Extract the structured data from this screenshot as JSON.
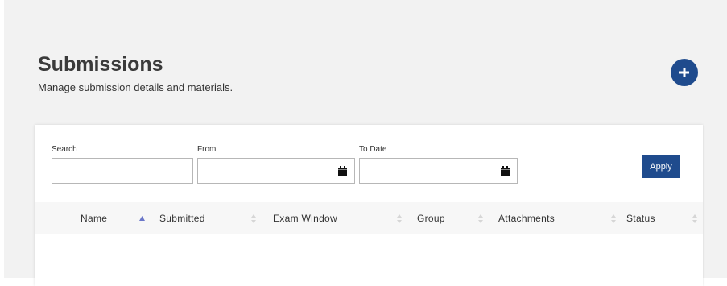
{
  "header": {
    "title": "Submissions",
    "subtitle": "Manage submission details and materials.",
    "add_icon": "plus-icon",
    "accent_color": "#1f4b8d"
  },
  "filters": {
    "search_label": "Search",
    "search_value": "",
    "from_label": "From",
    "from_value": "",
    "to_label": "To Date",
    "to_value": "",
    "calendar_icon": "calendar-icon",
    "apply_label": "Apply"
  },
  "table": {
    "columns": [
      {
        "label": "Name",
        "sort": "ascending"
      },
      {
        "label": "Submitted",
        "sort": "none"
      },
      {
        "label": "Exam Window",
        "sort": "none"
      },
      {
        "label": "Group",
        "sort": "none"
      },
      {
        "label": "Attachments",
        "sort": "none"
      },
      {
        "label": "Status",
        "sort": "none"
      }
    ],
    "rows": []
  }
}
